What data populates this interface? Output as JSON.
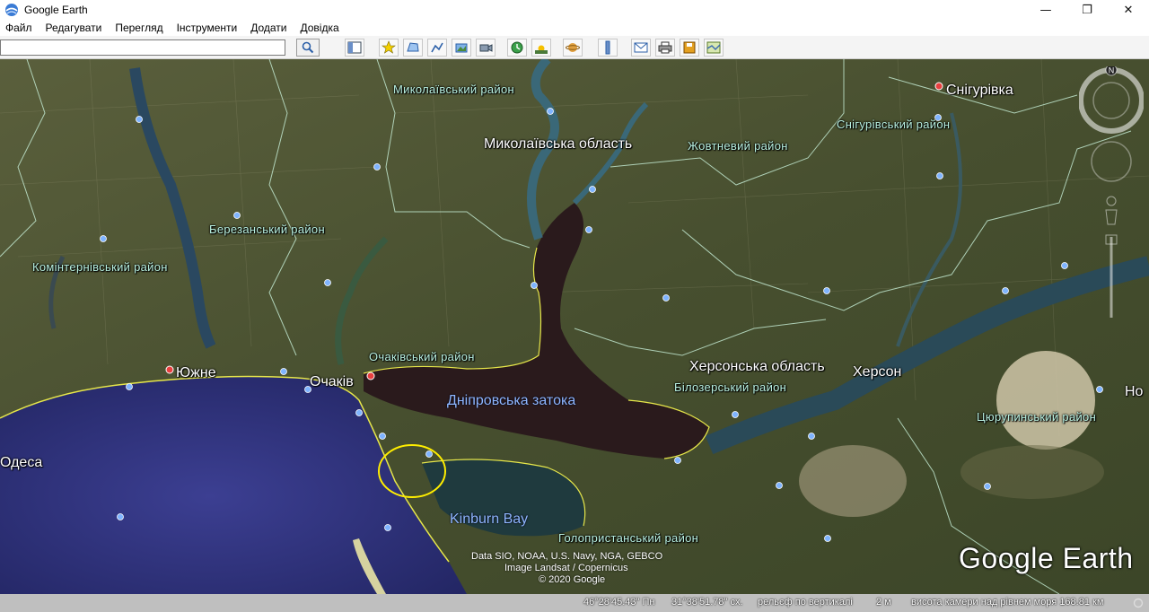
{
  "window": {
    "title": "Google Earth",
    "controls": {
      "minimize": "—",
      "maximize": "❐",
      "close": "✕"
    }
  },
  "menu": [
    "Файл",
    "Редагувати",
    "Перегляд",
    "Інструменти",
    "Додати",
    "Довідка"
  ],
  "toolbar": {
    "search_value": "",
    "buttons": [
      "sidebar-toggle-icon",
      "placemark-icon",
      "polygon-icon",
      "path-icon",
      "image-overlay-icon",
      "record-tour-icon",
      "historical-imagery-icon",
      "sunlight-icon",
      "planets-icon",
      "ruler-icon",
      "email-icon",
      "print-icon",
      "save-image-icon",
      "maps-icon"
    ]
  },
  "map": {
    "labels": {
      "mykolaiv_district": "Миколаївський район",
      "mykolaiv_oblast": "Миколаївська область",
      "zhovtnevyi": "Жовтневий район",
      "snihurivka": "Снігурівка",
      "snihurivskyi": "Снігурівський район",
      "berezanskyi": "Березанський район",
      "kominternivskyi": "Комінтернівський район",
      "ochakivskyi": "Очаківський район",
      "yuzhne": "Южне",
      "ochakiv": "Очаків",
      "dniprovska": "Дніпровська затока",
      "khersonska": "Херсонська область",
      "kherson": "Херсон",
      "bilozerskyi": "Білозерський район",
      "tsiurupynskyi": "Цюрупинський район",
      "odesa": "Одеса",
      "kinburn": "Kinburn Bay",
      "holoprystanskyi": "Голопристанський район",
      "edge": "Но"
    },
    "attribution": [
      "Data SIO, NOAA, U.S. Navy, NGA, GEBCO",
      "Image Landsat / Copernicus",
      "© 2020 Google"
    ],
    "brand": "Google Earth",
    "north": "N"
  },
  "status": {
    "lat": "46°28'45.43\" Пн",
    "lon": "31°38'51.78\" сх.",
    "elevation": "рельєф по вертикалі",
    "elev_value": "2 м",
    "camera": "висота камери над рівнем моря 168.81 км",
    "stream_icon": "streaming-indicator-icon"
  },
  "colors": {
    "sea": "#2a2f7a",
    "land": "#3f4a2a",
    "bay": "#2a1a1a",
    "border": "#c8f0d8",
    "coast": "#e6e64a",
    "highlight_circle": "#ffee00"
  }
}
